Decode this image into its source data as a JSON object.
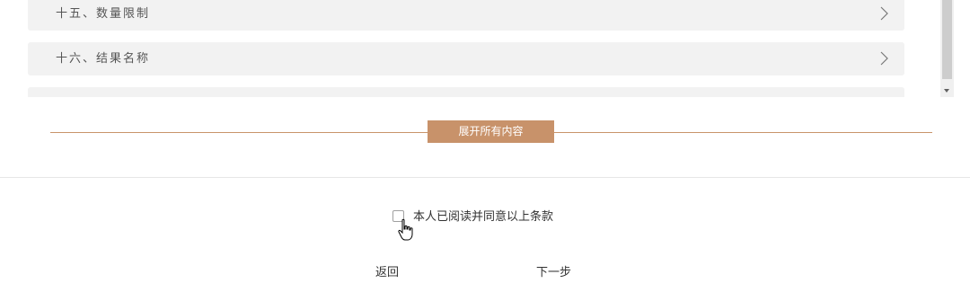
{
  "sections": [
    {
      "title": "十五、数量限制"
    },
    {
      "title": "十六、结果名称"
    },
    {
      "title": ""
    }
  ],
  "expand_button_label": "展开所有内容",
  "agreement": {
    "label": "本人已阅读并同意以上条款",
    "checked": false
  },
  "footer": {
    "back_label": "返回",
    "next_label": "下一步"
  },
  "colors": {
    "accent": "#c8926a",
    "item_background": "#f2f2f2"
  }
}
